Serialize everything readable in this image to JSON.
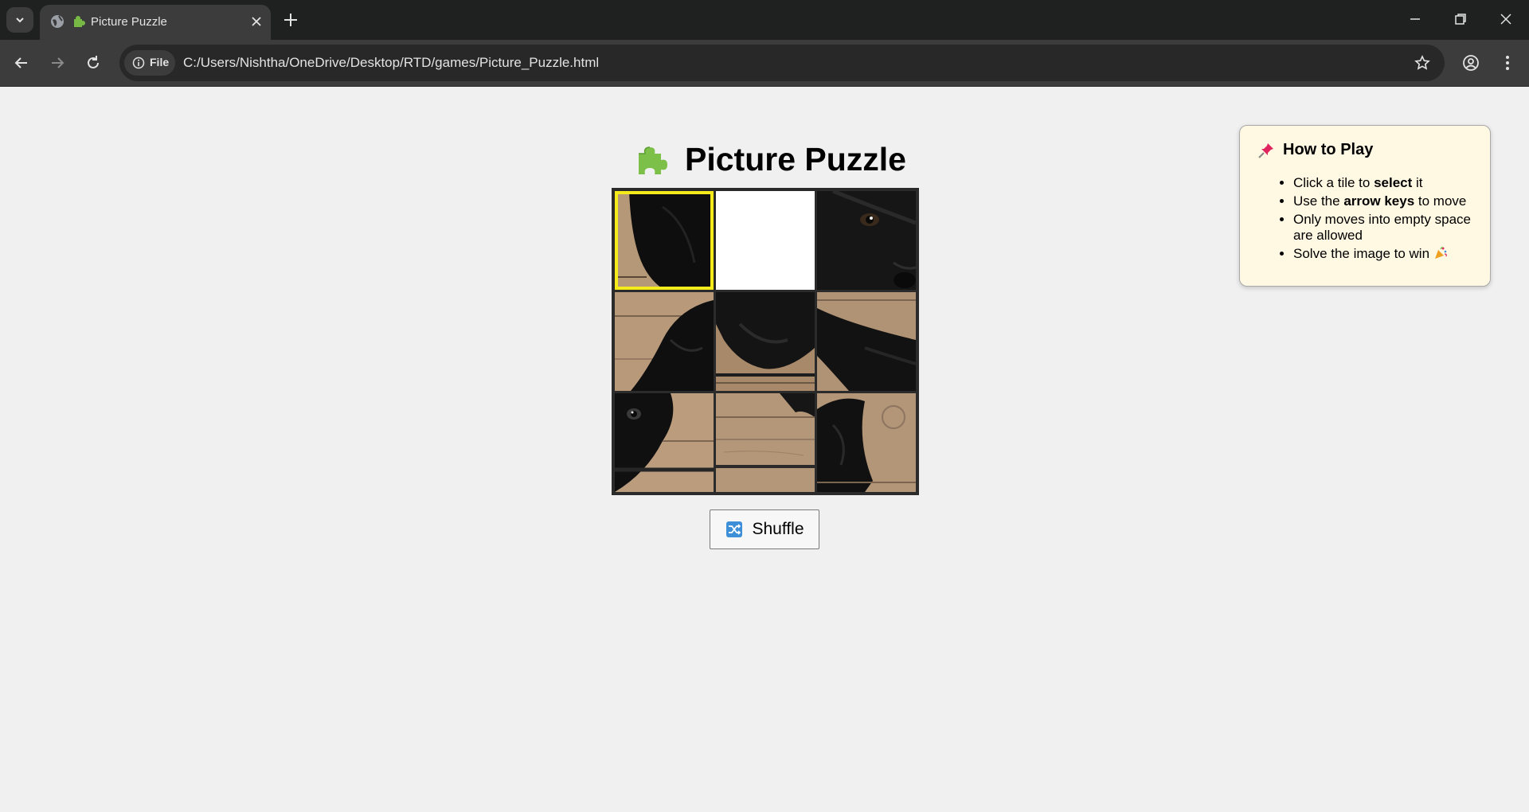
{
  "browser": {
    "tab_title": "Picture Puzzle",
    "address_chip": "File",
    "url": "C:/Users/Nishtha/OneDrive/Desktop/RTD/games/Picture_Puzzle.html"
  },
  "page": {
    "title": "Picture Puzzle",
    "title_icon": "puzzle-piece-icon",
    "shuffle_label": "Shuffle",
    "shuffle_icon": "shuffle-icon"
  },
  "board": {
    "grid": "3x3",
    "empty_tile": {
      "row": 0,
      "col": 1
    },
    "selected_tile": {
      "row": 0,
      "col": 0
    },
    "selection_color": "#f5ea1a",
    "image": "black puppy on wooden floor"
  },
  "how_to_play": {
    "heading": "How to Play",
    "heading_icon": "pushpin-icon",
    "rules": [
      {
        "before": "Click a tile to ",
        "bold": "select",
        "after": " it"
      },
      {
        "before": "Use the ",
        "bold": "arrow keys",
        "after": " to move"
      },
      {
        "before": "Only moves into empty space are allowed",
        "bold": "",
        "after": ""
      },
      {
        "before": "Solve the image to win ",
        "bold": "",
        "after": "",
        "icon": "party-popper-icon"
      }
    ]
  }
}
